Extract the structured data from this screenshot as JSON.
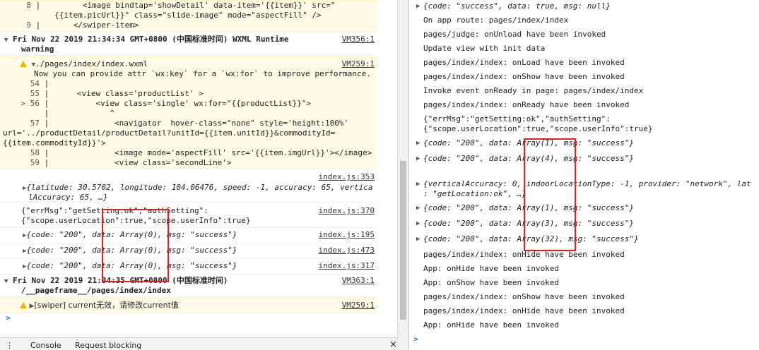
{
  "left": {
    "code_top": [
      {
        "num": "8",
        "text": "        <image bindtap='showDetail' data-item='{{item}}' src=\""
      },
      {
        "num": "",
        "text": "  {{item.picUrl}}\" class=\"slide-image\" mode=\"aspectFill\" />"
      },
      {
        "num": "9",
        "text": "      </swiper-item>"
      }
    ],
    "warning_header": {
      "text": "Fri Nov 22 2019 21:34:34 GMT+0800 (中国标准时间) WXML Runtime",
      "text2": "warning",
      "source": "VM356:1"
    },
    "wxml_warn": {
      "file": "./pages/index/index.wxml",
      "source": "VM259:1",
      "message": "Now you can provide attr `wx:key` for a `wx:for` to improve performance.",
      "lines": [
        {
          "num": "54",
          "text": ""
        },
        {
          "num": "55",
          "text": "     <view class='productList' >"
        },
        {
          "num": "> 56",
          "text": "         <view class='single' wx:for=\"{{productList}}\">"
        },
        {
          "num": "",
          "text": "            ^"
        },
        {
          "num": "57",
          "text": "             <navigator  hover-class=\"none\" style='height:100%'"
        },
        {
          "num": "",
          "text": "url='../productDetail/productDetail?unitId={{item.unitId}}&commodityId="
        },
        {
          "num": "",
          "text": "{{item.commodityId}}'>"
        },
        {
          "num": "58",
          "text": "             <image mode='aspectFill' src='{{item.imgUrl}}'></image>"
        },
        {
          "num": "59",
          "text": "             <view class='secondLine'>"
        }
      ]
    },
    "loc_log": {
      "source": "index.js:353",
      "line1": "{latitude: 30.5702, longitude: 104.06476, speed: -1, accuracy: 65, vertica",
      "line2": "lAccuracy: 65, …}"
    },
    "setting_log": {
      "source": "index.js:370",
      "line1": "{\"errMsg\":\"getSetting:ok\",\"authSetting\":",
      "line2": "{\"scope.userLocation\":true,\"scope.userInfo\":true}"
    },
    "code_logs": [
      {
        "text": "{code: \"200\", data: Array(0), msg: \"success\"}",
        "source": "index.js:195"
      },
      {
        "text": "{code: \"200\", data: Array(0), msg: \"success\"}",
        "source": "index.js:473"
      },
      {
        "text": "{code: \"200\", data: Array(0), msg: \"success\"}",
        "source": "index.js:317"
      }
    ],
    "page_header": {
      "text": "Fri Nov 22 2019 21:34:35 GMT+0800 (中国标准时间)",
      "text2": "/__pageframe__/pages/index/index",
      "source": "VM363:1"
    },
    "swiper_warn": {
      "text": "[swiper] current无效，请修改current值",
      "source": "VM259:1"
    },
    "prompt": ">",
    "tabs": [
      "Console",
      "Request blocking"
    ],
    "close": "×"
  },
  "right": {
    "rows": [
      {
        "text": "{code: \"success\", data: true, msg: null}",
        "expand": true
      },
      {
        "text": "On app route: pages/index/index"
      },
      {
        "text": "pages/judge: onUnload have been invoked"
      },
      {
        "text": "Update view with init data"
      },
      {
        "text": "pages/index/index: onLoad have been invoked"
      },
      {
        "text": "pages/index/index: onShow have been invoked"
      },
      {
        "text": "Invoke event onReady in page: pages/index/index"
      },
      {
        "text": "pages/index/index: onReady have been invoked"
      },
      {
        "text": "{\"errMsg\":\"getSetting:ok\",\"authSetting\":",
        "text2": "{\"scope.userLocation\":true,\"scope.userInfo\":true}"
      },
      {
        "text": "{code: \"200\", data: Array(1), msg: \"success\"}",
        "expand": true
      },
      {
        "text": "{code: \"200\", data: Array(4), msg: \"success\"}",
        "expand": true
      },
      {
        "text": "{verticalAccuracy: 0, indoorLocationType: -1, provider: \"network\", lat",
        "text2": ": \"getLocation:ok\", …}",
        "expand": true
      },
      {
        "text": "{code: \"200\", data: Array(1), msg: \"success\"}",
        "expand": true
      },
      {
        "text": "{code: \"200\", data: Array(3), msg: \"success\"}",
        "expand": true
      },
      {
        "text": "{code: \"200\", data: Array(32), msg: \"success\"}",
        "expand": true
      },
      {
        "text": "pages/index/index: onHide have been invoked"
      },
      {
        "text": "App: onHide have been invoked"
      },
      {
        "text": "App: onShow have been invoked"
      },
      {
        "text": "pages/index/index: onShow have been invoked"
      },
      {
        "text": "pages/index/index: onHide have been invoked"
      },
      {
        "text": "App: onHide have been invoked"
      }
    ],
    "prompt": ">"
  },
  "colors": {
    "highlight_box": "#e02020",
    "warn_bg": "#fffbe6",
    "link": "#333333",
    "prompt": "#1a73e8"
  }
}
